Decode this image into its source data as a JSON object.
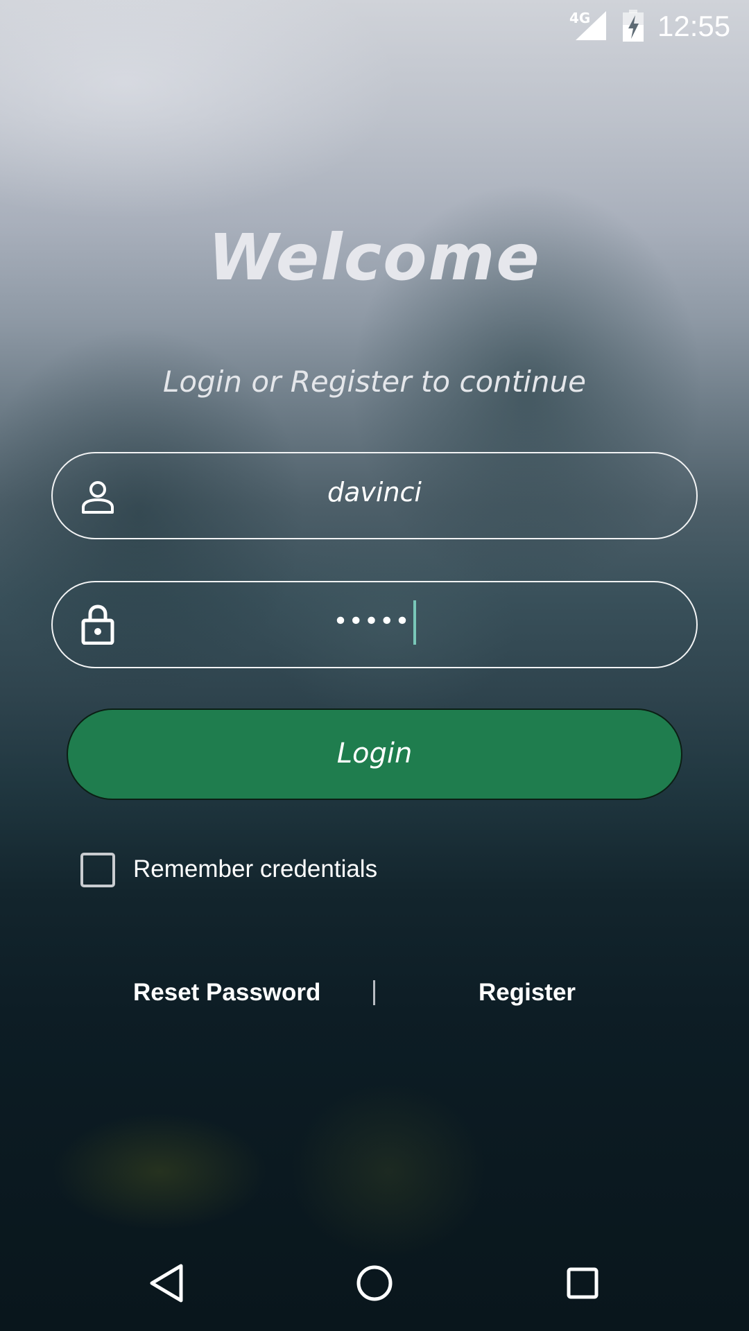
{
  "status_bar": {
    "network": "4G",
    "time": "12:55",
    "icons": [
      "signal-icon",
      "battery-charging-icon"
    ]
  },
  "header": {
    "title": "Welcome",
    "subtitle": "Login or Register to continue"
  },
  "form": {
    "username": {
      "icon": "user-icon",
      "value": "davinci"
    },
    "password": {
      "icon": "lock-icon",
      "value": "•••••"
    },
    "login_label": "Login",
    "remember_label": "Remember credentials",
    "remember_checked": false
  },
  "links": {
    "reset_password": "Reset Password",
    "separator": "|",
    "register": "Register"
  },
  "nav_bar": {
    "icons": [
      "back-icon",
      "home-icon",
      "recent-apps-icon"
    ]
  },
  "colors": {
    "login_button": "#1f7d4e",
    "caret": "#79c7b8",
    "text": "#ffffff"
  }
}
